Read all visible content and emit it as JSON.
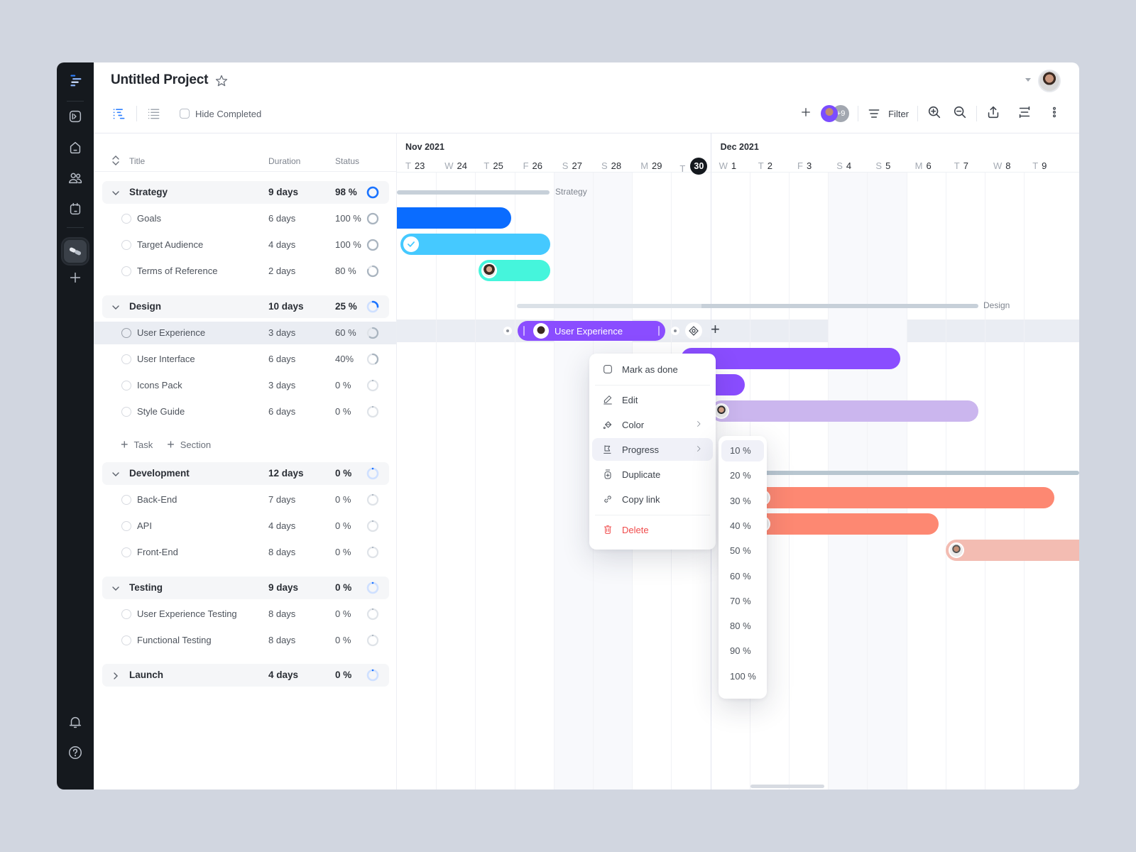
{
  "project": {
    "title": "Untitled Project"
  },
  "toolbar": {
    "hide_completed_label": "Hide Completed",
    "hide_completed_checked": false,
    "filter_label": "Filter",
    "members_extra": "+9"
  },
  "sidebar": {
    "items": [
      {
        "icon": "logo-icon"
      },
      {
        "icon": "code-icon"
      },
      {
        "icon": "home-icon"
      },
      {
        "icon": "users-icon"
      },
      {
        "icon": "calendar-icon"
      },
      {
        "icon": "project-icon",
        "active": true
      },
      {
        "icon": "plus-icon"
      },
      {
        "icon": "bell-icon"
      },
      {
        "icon": "help-icon"
      }
    ]
  },
  "table": {
    "headers": {
      "title": "Title",
      "duration": "Duration",
      "status": "Status"
    },
    "rows": [
      {
        "type": "section",
        "name": "Strategy",
        "duration": "9 days",
        "status": "98 %",
        "progress": 98,
        "expanded": true
      },
      {
        "type": "task",
        "name": "Goals",
        "duration": "6 days",
        "status": "100 %",
        "progress": 100
      },
      {
        "type": "task",
        "name": "Target Audience",
        "duration": "4 days",
        "status": "100 %",
        "progress": 100
      },
      {
        "type": "task",
        "name": "Terms of Reference",
        "duration": "2 days",
        "status": "80 %",
        "progress": 80
      },
      {
        "type": "section",
        "name": "Design",
        "duration": "10 days",
        "status": "25 %",
        "progress": 25,
        "expanded": true
      },
      {
        "type": "task",
        "name": "User Experience",
        "duration": "3 days",
        "status": "60 %",
        "progress": 60,
        "selected": true
      },
      {
        "type": "task",
        "name": "User Interface",
        "duration": "6 days",
        "status": "40%",
        "progress": 40
      },
      {
        "type": "task",
        "name": "Icons Pack",
        "duration": "3 days",
        "status": "0 %",
        "progress": 0
      },
      {
        "type": "task",
        "name": "Style Guide",
        "duration": "6 days",
        "status": "0 %",
        "progress": 0
      },
      {
        "type": "section",
        "name": "Development",
        "duration": "12 days",
        "status": "0 %",
        "progress": 0,
        "expanded": true
      },
      {
        "type": "task",
        "name": "Back-End",
        "duration": "7 days",
        "status": "0 %",
        "progress": 0
      },
      {
        "type": "task",
        "name": "API",
        "duration": "4 days",
        "status": "0 %",
        "progress": 0
      },
      {
        "type": "task",
        "name": "Front-End",
        "duration": "8 days",
        "status": "0 %",
        "progress": 0
      },
      {
        "type": "section",
        "name": "Testing",
        "duration": "9 days",
        "status": "0 %",
        "progress": 0,
        "expanded": true
      },
      {
        "type": "task",
        "name": "User Experience Testing",
        "duration": "8 days",
        "status": "0 %",
        "progress": 0
      },
      {
        "type": "task",
        "name": "Functional Testing",
        "duration": "8 days",
        "status": "0 %",
        "progress": 0
      },
      {
        "type": "section",
        "name": "Launch",
        "duration": "4 days",
        "status": "0 %",
        "progress": 0,
        "expanded": false
      }
    ],
    "add_task_label": "Task",
    "add_section_label": "Section"
  },
  "timeline": {
    "months": [
      {
        "label": "Nov 2021"
      },
      {
        "label": "Dec 2021"
      }
    ],
    "days": [
      {
        "wd": "T",
        "d": "23"
      },
      {
        "wd": "W",
        "d": "24"
      },
      {
        "wd": "T",
        "d": "25"
      },
      {
        "wd": "F",
        "d": "26"
      },
      {
        "wd": "S",
        "d": "27",
        "weekend": true
      },
      {
        "wd": "S",
        "d": "28",
        "weekend": true
      },
      {
        "wd": "M",
        "d": "29"
      },
      {
        "wd": "T",
        "d": "30",
        "today": true
      },
      {
        "wd": "W",
        "d": "1"
      },
      {
        "wd": "T",
        "d": "2"
      },
      {
        "wd": "F",
        "d": "3"
      },
      {
        "wd": "S",
        "d": "4",
        "weekend": true
      },
      {
        "wd": "S",
        "d": "5",
        "weekend": true
      },
      {
        "wd": "M",
        "d": "6"
      },
      {
        "wd": "T",
        "d": "7"
      },
      {
        "wd": "W",
        "d": "8"
      },
      {
        "wd": "T",
        "d": "9"
      }
    ],
    "section_labels": {
      "strategy": "Strategy",
      "design": "Design"
    },
    "selected_bar_label": "User Experience",
    "colors": {
      "goals": "#0a6cff",
      "target_audience": "#45c9ff",
      "terms": "#45f5dc",
      "design": "#8a4dff",
      "style_guide": "#cbb6ee",
      "development": "#fd8872",
      "frontend": "#f3bcb2",
      "section_bar": "#c7d0d9"
    }
  },
  "context_menu": {
    "items": [
      {
        "label": "Mark as done",
        "icon": "checkbox-icon"
      },
      {
        "label": "Edit",
        "icon": "pencil-icon"
      },
      {
        "label": "Color",
        "icon": "paint-bucket-icon",
        "submenu": true
      },
      {
        "label": "Progress",
        "icon": "flag-icon",
        "submenu": true,
        "highlighted": true
      },
      {
        "label": "Duplicate",
        "icon": "duplicate-icon"
      },
      {
        "label": "Copy link",
        "icon": "link-icon"
      },
      {
        "label": "Delete",
        "icon": "trash-icon",
        "danger": true
      }
    ]
  },
  "progress_submenu": {
    "options": [
      "10 %",
      "20 %",
      "30 %",
      "40 %",
      "50 %",
      "60 %",
      "70 %",
      "80 %",
      "90 %",
      "100 %"
    ],
    "highlighted_index": 0
  }
}
